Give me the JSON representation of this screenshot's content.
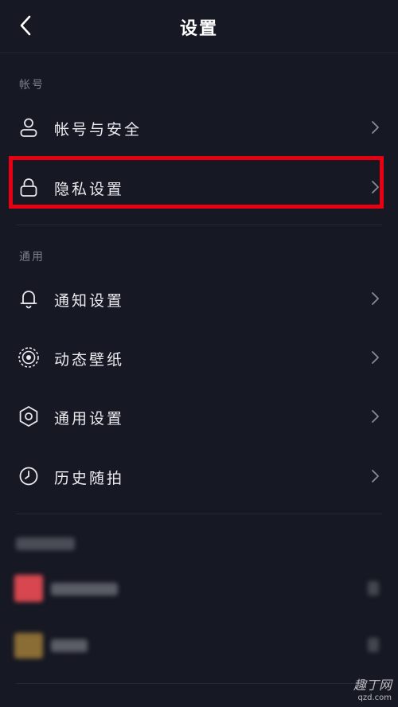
{
  "header": {
    "title": "设置",
    "back_label": "返回"
  },
  "sections": [
    {
      "title": "帐号",
      "items": [
        {
          "label": "帐号与安全",
          "icon": "person-icon"
        },
        {
          "label": "隐私设置",
          "icon": "lock-icon",
          "highlighted": true
        }
      ]
    },
    {
      "title": "通用",
      "items": [
        {
          "label": "通知设置",
          "icon": "bell-icon"
        },
        {
          "label": "动态壁纸",
          "icon": "live-wallpaper-icon"
        },
        {
          "label": "通用设置",
          "icon": "gear-icon"
        },
        {
          "label": "历史随拍",
          "icon": "history-clock-icon"
        }
      ]
    }
  ],
  "watermark": {
    "main": "趣丁网",
    "sub": "qzd.com"
  },
  "colors": {
    "background": "#161823",
    "text": "#ececf0",
    "muted": "#7d7f88",
    "highlight": "#e60012"
  }
}
